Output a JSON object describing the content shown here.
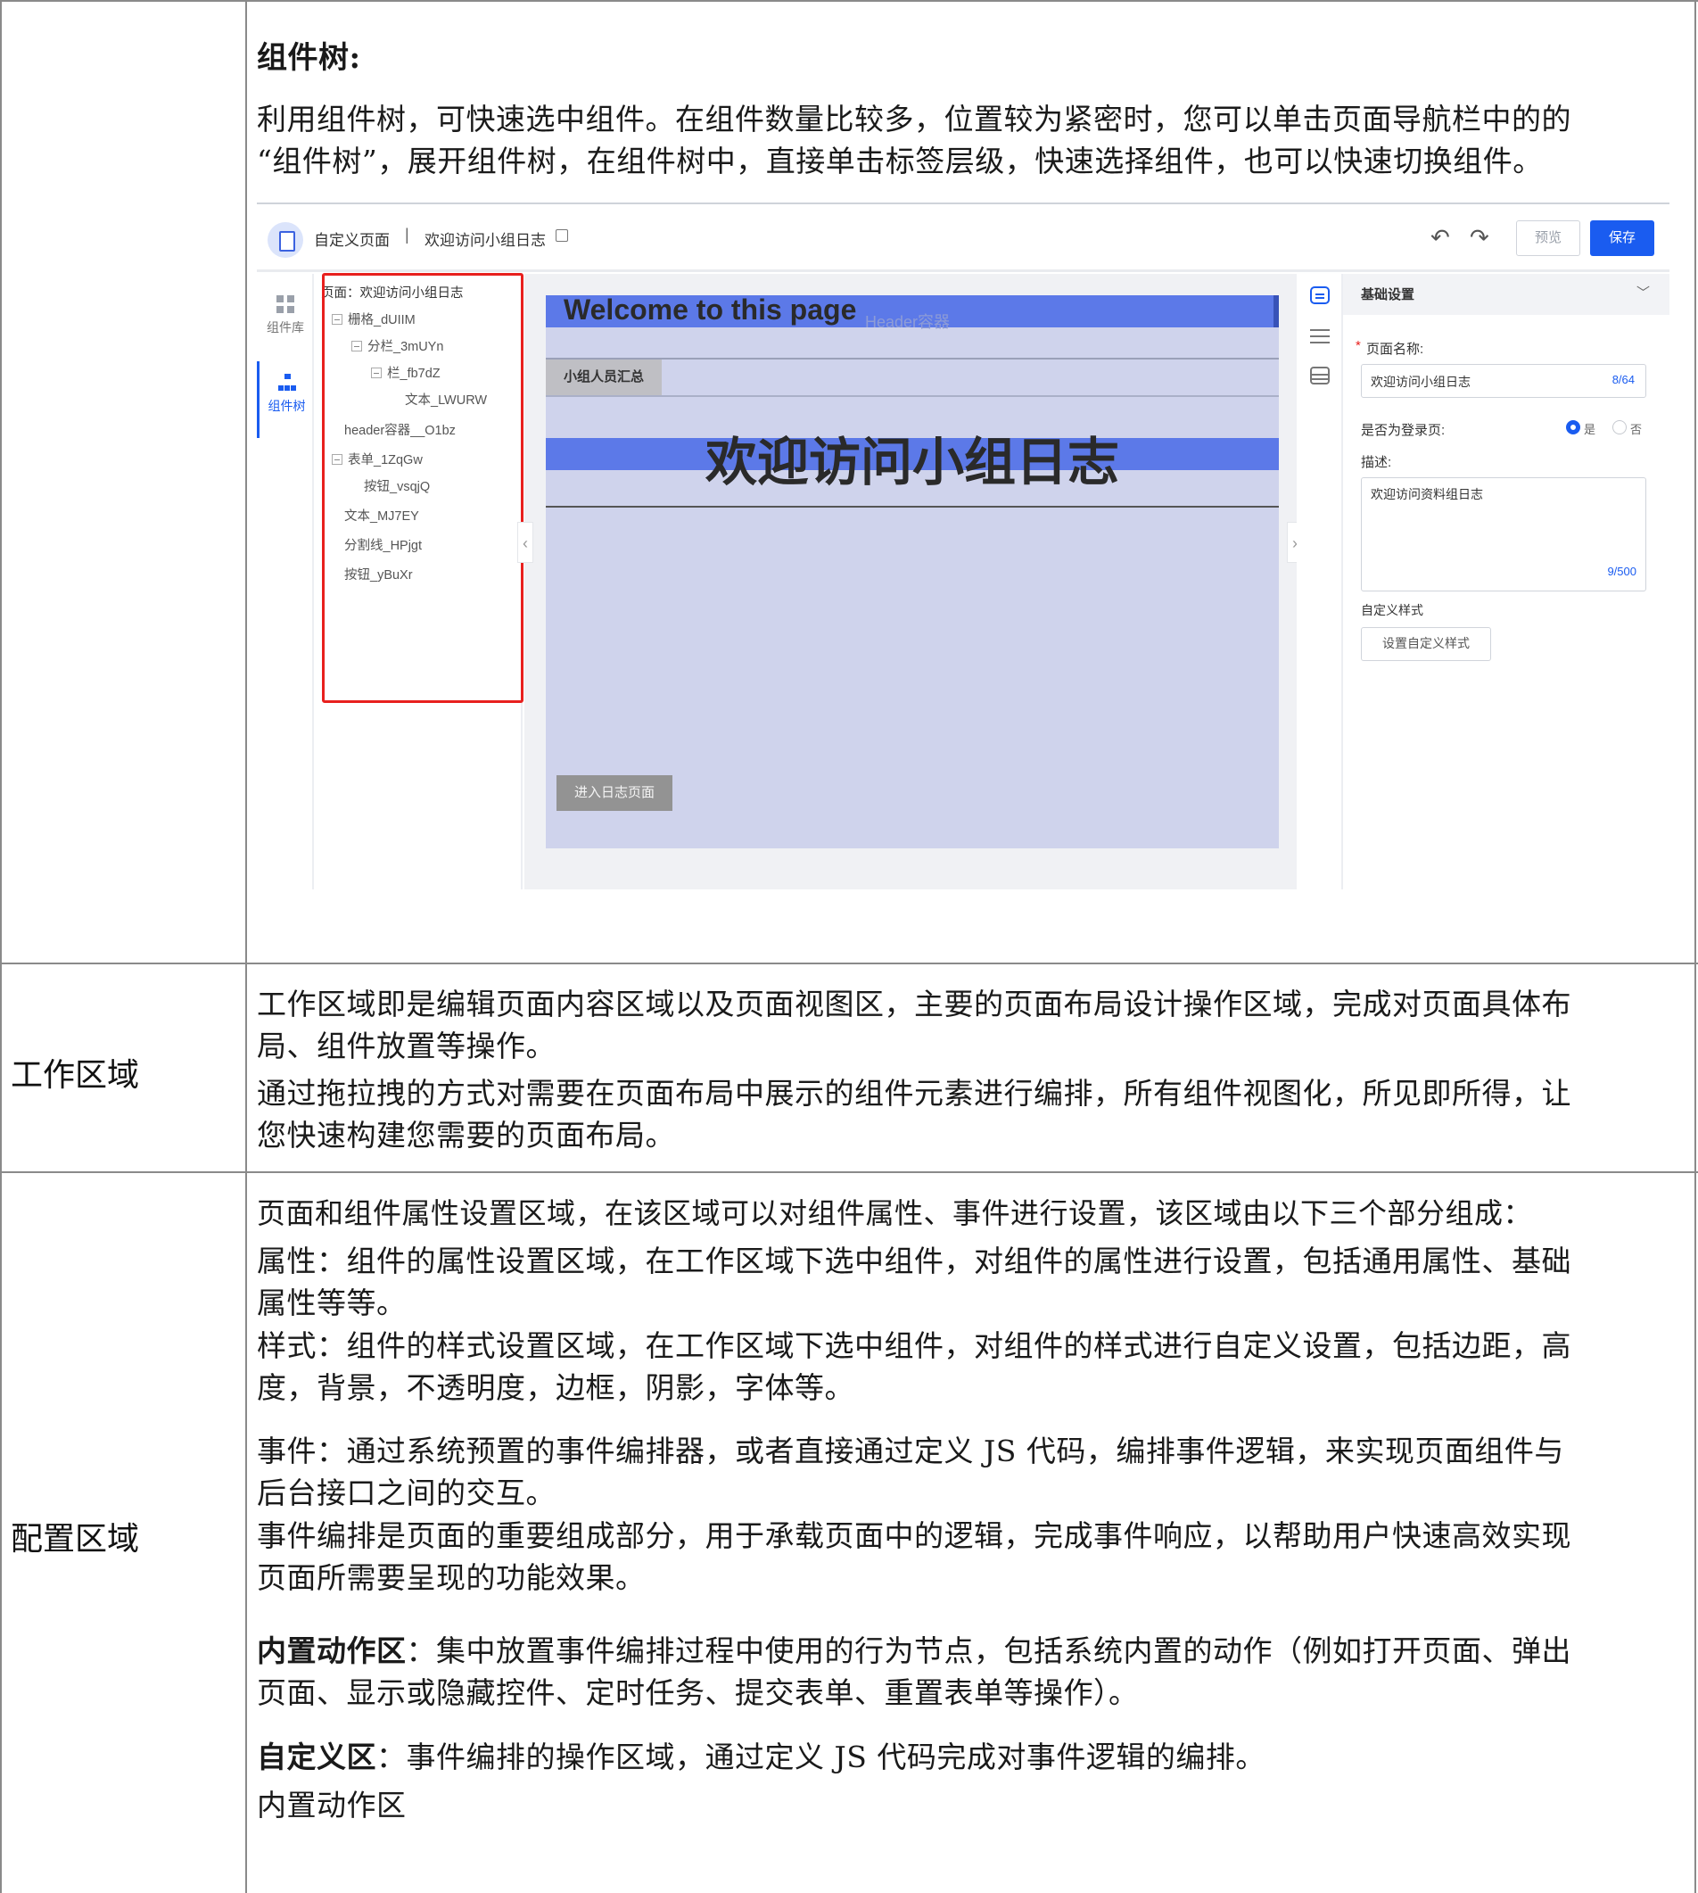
{
  "rows": {
    "tree": {
      "heading": "组件树:",
      "desc_lines": [
        "利用组件树，可快速选中组件。在组件数量比较多，位置较为紧密时，您可以单击页面导航栏中的的",
        "“组件树”，展开组件树，在组件树中，直接单击标签层级，快速选择组件，也可以快速切换组件。"
      ]
    },
    "work": {
      "label": "工作区域",
      "lines": [
        "工作区域即是编辑页面内容区域以及页面视图区，主要的页面布局设计操作区域，完成对页面具体布",
        "局、组件放置等操作。",
        "通过拖拉拽的方式对需要在页面布局中展示的组件元素进行编排，所有组件视图化，所见即所得，让",
        "您快速构建您需要的页面布局。"
      ]
    },
    "config": {
      "label": "配置区域",
      "intro": "页面和组件属性设置区域，在该区域可以对组件属性、事件进行设置，该区域由以下三个部分组成：",
      "attr_lines": [
        "属性：组件的属性设置区域，在工作区域下选中组件，对组件的属性进行设置，包括通用属性、基础",
        "属性等等。"
      ],
      "style_lines": [
        "样式：组件的样式设置区域，在工作区域下选中组件，对组件的样式进行自定义设置，包括边距，高",
        "度，背景，不透明度，边框，阴影，字体等。"
      ],
      "event_lines": [
        "事件：通过系统预置的事件编排器，或者直接通过定义 JS 代码，编排事件逻辑，来实现页面组件与",
        "后台接口之间的交互。",
        "事件编排是页面的重要组成部分，用于承载页面中的逻辑，完成事件响应，以帮助用户快速高效实现",
        "页面所需要呈现的功能效果。"
      ],
      "builtin_bold": "内置动作区",
      "builtin_text_1": "：集中放置事件编排过程中使用的行为节点，包括系统内置的动作（例如打开页面、弹出",
      "builtin_text_2": "页面、显示或隐藏控件、定时任务、提交表单、重置表单等操作）。",
      "custom_bold": "自定义区",
      "custom_text": "：事件编排的操作区域，通过定义 JS 代码完成对事件逻辑的编排。",
      "tail": "内置动作区"
    }
  },
  "editor": {
    "toolbar": {
      "crumb_page_type": "自定义页面",
      "separator": "|",
      "crumb_page_name": "欢迎访问小组日志",
      "preview_label": "预览",
      "save_label": "保存"
    },
    "rail": {
      "component_lib": "组件库",
      "component_tree": "组件树"
    },
    "tree": {
      "root": "页面：欢迎访问小组日志",
      "nodes": [
        "栅格_dUIIM",
        "分栏_3mUYn",
        "栏_fb7dZ",
        "文本_LWURW",
        "header容器__O1bz",
        "表单_1ZqGw",
        "按钮_vsqjQ",
        "文本_MJ7EY",
        "分割线_HPjgt",
        "按钮_yBuXr"
      ]
    },
    "canvas": {
      "welcome": "Welcome to this page",
      "header_ghost": "Header容器",
      "tab_chip": "小组人员汇总",
      "big_title": "欢迎访问小组日志",
      "enter_btn": "进入日志页面"
    },
    "config": {
      "section_title": "基础设置",
      "required_mark": "*",
      "page_name_label": "页面名称:",
      "page_name_value": "欢迎访问小组日志",
      "page_name_count": "8/64",
      "login_label": "是否为登录页:",
      "radio_yes": "是",
      "radio_no": "否",
      "desc_label": "描述:",
      "desc_value": "欢迎访问资料组日志",
      "desc_count": "9/500",
      "custom_style_label": "自定义样式",
      "custom_style_btn": "设置自定义样式"
    }
  },
  "colors": {
    "accent": "#1a5cf0",
    "highlight_border": "#e8201e",
    "canvas_bar": "#5c79e8",
    "canvas_bg": "#cfd3ec"
  }
}
